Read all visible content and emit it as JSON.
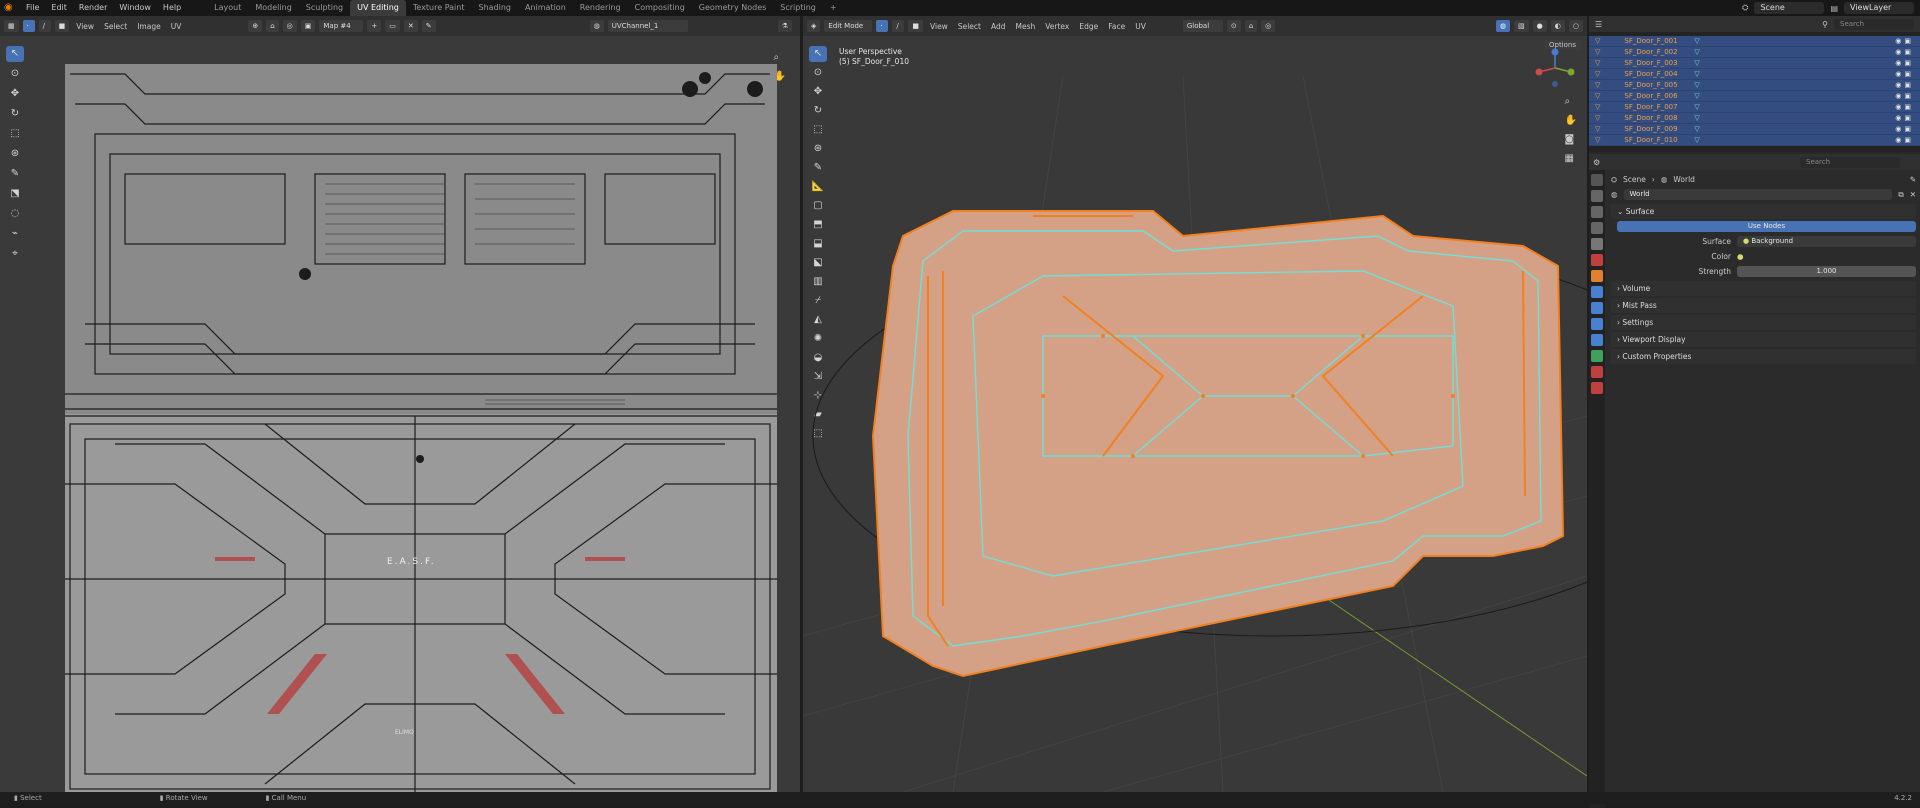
{
  "topbar": {
    "menus": [
      "File",
      "Edit",
      "Render",
      "Window",
      "Help"
    ],
    "workspaces": [
      "Layout",
      "Modeling",
      "Sculpting",
      "UV Editing",
      "Texture Paint",
      "Shading",
      "Animation",
      "Rendering",
      "Compositing",
      "Geometry Nodes",
      "Scripting"
    ],
    "active_workspace": "UV Editing",
    "scene": "Scene",
    "view_layer": "ViewLayer"
  },
  "uv_editor": {
    "menus": [
      "View",
      "Select",
      "Image",
      "UV"
    ],
    "image_name": "Map #4",
    "uv_channel": "UVChannel_1",
    "texture_label_top": "E.A.S.F.",
    "texture_label_bottom": "ELIMO"
  },
  "viewport": {
    "mode": "Edit Mode",
    "menus": [
      "View",
      "Select",
      "Add",
      "Mesh",
      "Vertex",
      "Edge",
      "Face",
      "UV"
    ],
    "orientation": "Global",
    "options_label": "Options",
    "view_name": "User Perspective",
    "object_info": "(5) SF_Door_F_010",
    "axes": [
      "X",
      "Y",
      "Z"
    ]
  },
  "outliner": {
    "search_placeholder": "Search",
    "items": [
      "SF_Door_F_001",
      "SF_Door_F_002",
      "SF_Door_F_003",
      "SF_Door_F_004",
      "SF_Door_F_005",
      "SF_Door_F_006",
      "SF_Door_F_007",
      "SF_Door_F_008",
      "SF_Door_F_009",
      "SF_Door_F_010"
    ]
  },
  "properties": {
    "search_placeholder": "Search",
    "breadcrumb_scene": "Scene",
    "breadcrumb_world": "World",
    "world_name": "World",
    "panels": {
      "surface": "Surface",
      "use_nodes": "Use Nodes",
      "surface_label": "Surface",
      "surface_value": "Background",
      "color_label": "Color",
      "strength_label": "Strength",
      "strength_value": "1.000",
      "volume": "Volume",
      "mist": "Mist Pass",
      "settings": "Settings",
      "viewport_display": "Viewport Display",
      "custom_props": "Custom Properties"
    }
  },
  "statusbar": {
    "select": "Select",
    "rotate": "Rotate View",
    "menu": "Call Menu",
    "version": "4.2.2"
  },
  "colors": {
    "accent": "#4772b3",
    "selected_orange": "#f0a047",
    "mesh_cyan": "#6fe0d8",
    "mesh_fill": "#d79a7b"
  }
}
